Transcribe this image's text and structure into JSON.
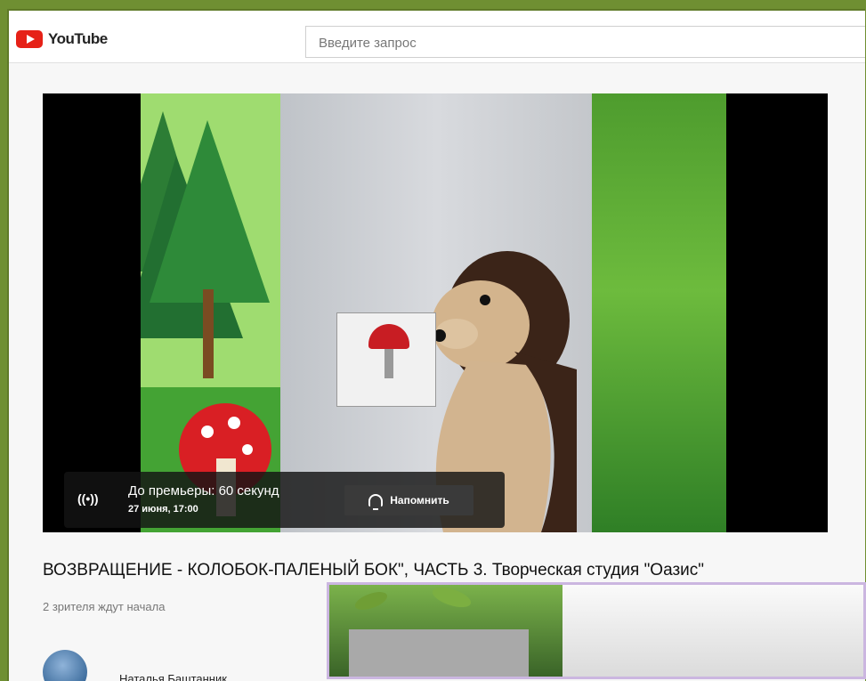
{
  "topbar": {
    "logo_text": "YouTube",
    "search_placeholder": "Введите запрос"
  },
  "player": {
    "live_icon_text": "((•))",
    "premiere_title": "До премьеры: 60 секунд",
    "premiere_date": "27 июня, 17:00",
    "remind_label": "Напомнить"
  },
  "video": {
    "title": "ВОЗВРАЩЕНИЕ - КОЛОБОК-ПАЛЕНЫЙ БОК\", ЧАСТЬ 3. Творческая студия \"Оазис\"",
    "viewers": "2 зрителя ждут начала"
  },
  "channel": {
    "name": "Наталья Баштанник"
  },
  "colors": {
    "frame_green": "#6f8f32",
    "youtube_red": "#e62117"
  }
}
